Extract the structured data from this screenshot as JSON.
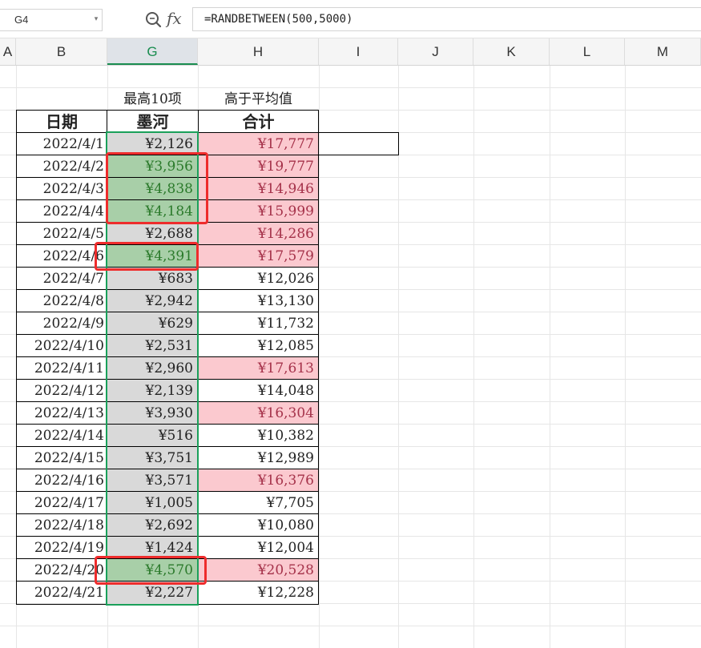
{
  "formula_bar": {
    "name_box": "G4",
    "formula": "=RANDBETWEEN(500,5000)",
    "icons": [
      "zoom-formula-icon",
      "fx-icon"
    ]
  },
  "columns": [
    {
      "id": "A",
      "label": "A"
    },
    {
      "id": "B",
      "label": "B"
    },
    {
      "id": "G",
      "label": "G"
    },
    {
      "id": "H",
      "label": "H"
    },
    {
      "id": "I",
      "label": "I"
    },
    {
      "id": "J",
      "label": "J"
    },
    {
      "id": "K",
      "label": "K"
    },
    {
      "id": "L",
      "label": "L"
    },
    {
      "id": "M",
      "label": "M"
    }
  ],
  "selected_column": "G",
  "sheet": {
    "caption_g": "最高10项",
    "caption_h": "高于平均值",
    "header_date": "日期",
    "header_g": "墨河",
    "header_h": "合计",
    "rows": [
      {
        "date": "2022/4/1",
        "g": "¥2,126",
        "h": "¥17,777",
        "g_hi": false,
        "h_hi": true
      },
      {
        "date": "2022/4/2",
        "g": "¥3,956",
        "h": "¥19,777",
        "g_hi": true,
        "h_hi": true
      },
      {
        "date": "2022/4/3",
        "g": "¥4,838",
        "h": "¥14,946",
        "g_hi": true,
        "h_hi": true
      },
      {
        "date": "2022/4/4",
        "g": "¥4,184",
        "h": "¥15,999",
        "g_hi": true,
        "h_hi": true
      },
      {
        "date": "2022/4/5",
        "g": "¥2,688",
        "h": "¥14,286",
        "g_hi": false,
        "h_hi": true
      },
      {
        "date": "2022/4/6",
        "g": "¥4,391",
        "h": "¥17,579",
        "g_hi": true,
        "h_hi": true
      },
      {
        "date": "2022/4/7",
        "g": "¥683",
        "h": "¥12,026",
        "g_hi": false,
        "h_hi": false
      },
      {
        "date": "2022/4/8",
        "g": "¥2,942",
        "h": "¥13,130",
        "g_hi": false,
        "h_hi": false
      },
      {
        "date": "2022/4/9",
        "g": "¥629",
        "h": "¥11,732",
        "g_hi": false,
        "h_hi": false
      },
      {
        "date": "2022/4/10",
        "g": "¥2,531",
        "h": "¥12,085",
        "g_hi": false,
        "h_hi": false
      },
      {
        "date": "2022/4/11",
        "g": "¥2,960",
        "h": "¥17,613",
        "g_hi": false,
        "h_hi": true
      },
      {
        "date": "2022/4/12",
        "g": "¥2,139",
        "h": "¥14,048",
        "g_hi": false,
        "h_hi": false
      },
      {
        "date": "2022/4/13",
        "g": "¥3,930",
        "h": "¥16,304",
        "g_hi": false,
        "h_hi": true
      },
      {
        "date": "2022/4/14",
        "g": "¥516",
        "h": "¥10,382",
        "g_hi": false,
        "h_hi": false
      },
      {
        "date": "2022/4/15",
        "g": "¥3,751",
        "h": "¥12,989",
        "g_hi": false,
        "h_hi": false
      },
      {
        "date": "2022/4/16",
        "g": "¥3,571",
        "h": "¥16,376",
        "g_hi": false,
        "h_hi": true
      },
      {
        "date": "2022/4/17",
        "g": "¥1,005",
        "h": "¥7,705",
        "g_hi": false,
        "h_hi": false
      },
      {
        "date": "2022/4/18",
        "g": "¥2,692",
        "h": "¥10,080",
        "g_hi": false,
        "h_hi": false
      },
      {
        "date": "2022/4/19",
        "g": "¥1,424",
        "h": "¥12,004",
        "g_hi": false,
        "h_hi": false
      },
      {
        "date": "2022/4/20",
        "g": "¥4,570",
        "h": "¥20,528",
        "g_hi": true,
        "h_hi": true
      },
      {
        "date": "2022/4/21",
        "g": "¥2,227",
        "h": "¥12,228",
        "g_hi": false,
        "h_hi": false
      }
    ]
  },
  "colors": {
    "green_fill": "#a8cfa8",
    "green_text": "#2b7a2b",
    "pink_fill": "#fbc9cf",
    "pink_text": "#a5324a",
    "gray_fill": "#d9d9d9",
    "selection": "#1aa05a",
    "annotation": "#ee2c2c"
  }
}
